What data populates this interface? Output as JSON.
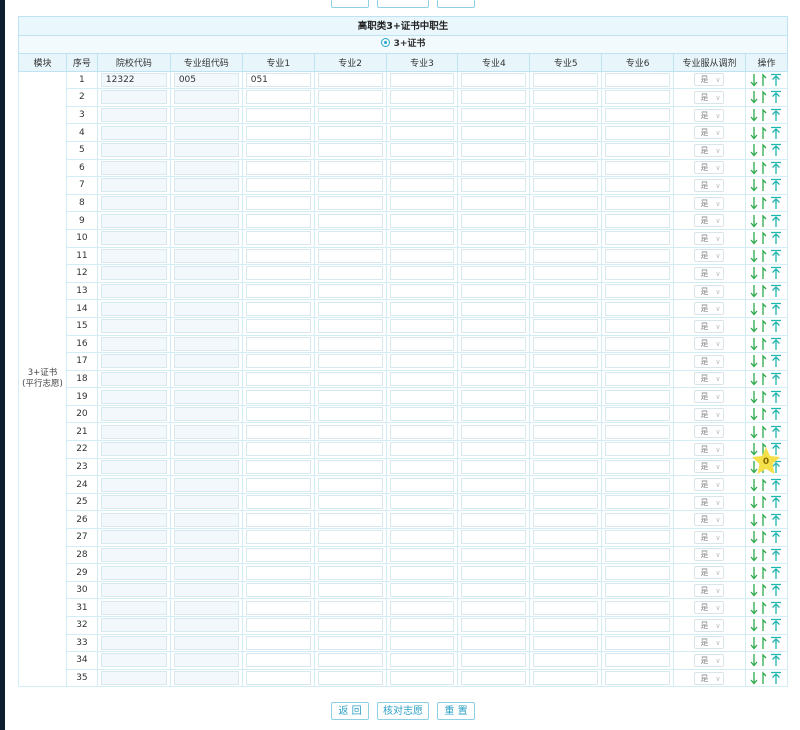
{
  "top_buttons": [
    "",
    "",
    ""
  ],
  "header": {
    "title": "高职类3+证书中职生",
    "radio_label": "3+证书"
  },
  "columns": [
    "模块",
    "序号",
    "院校代码",
    "专业组代码",
    "专业1",
    "专业2",
    "专业3",
    "专业4",
    "专业5",
    "专业6",
    "专业服从调剂",
    "操作"
  ],
  "module": {
    "line1": "3+证书",
    "line2": "(平行志愿)"
  },
  "rows": [
    {
      "seq": "1",
      "school": "12322",
      "group": "005",
      "m1": "051",
      "adjust": "是"
    },
    {
      "seq": "2",
      "adjust": "是"
    },
    {
      "seq": "3",
      "adjust": "是"
    },
    {
      "seq": "4",
      "adjust": "是"
    },
    {
      "seq": "5",
      "adjust": "是"
    },
    {
      "seq": "6",
      "adjust": "是"
    },
    {
      "seq": "7",
      "adjust": "是"
    },
    {
      "seq": "8",
      "adjust": "是"
    },
    {
      "seq": "9",
      "adjust": "是"
    },
    {
      "seq": "10",
      "adjust": "是"
    },
    {
      "seq": "11",
      "adjust": "是"
    },
    {
      "seq": "12",
      "adjust": "是"
    },
    {
      "seq": "13",
      "adjust": "是"
    },
    {
      "seq": "14",
      "adjust": "是"
    },
    {
      "seq": "15",
      "adjust": "是"
    },
    {
      "seq": "16",
      "adjust": "是"
    },
    {
      "seq": "17",
      "adjust": "是"
    },
    {
      "seq": "18",
      "adjust": "是"
    },
    {
      "seq": "19",
      "adjust": "是"
    },
    {
      "seq": "20",
      "adjust": "是"
    },
    {
      "seq": "21",
      "adjust": "是"
    },
    {
      "seq": "22",
      "adjust": "是"
    },
    {
      "seq": "23",
      "adjust": "是"
    },
    {
      "seq": "24",
      "adjust": "是"
    },
    {
      "seq": "25",
      "adjust": "是"
    },
    {
      "seq": "26",
      "adjust": "是"
    },
    {
      "seq": "27",
      "adjust": "是"
    },
    {
      "seq": "28",
      "adjust": "是"
    },
    {
      "seq": "29",
      "adjust": "是"
    },
    {
      "seq": "30",
      "adjust": "是"
    },
    {
      "seq": "31",
      "adjust": "是"
    },
    {
      "seq": "32",
      "adjust": "是"
    },
    {
      "seq": "33",
      "adjust": "是"
    },
    {
      "seq": "34",
      "adjust": "是"
    },
    {
      "seq": "35",
      "adjust": "是"
    }
  ],
  "ops_icons": [
    "move-down-icon",
    "move-up-icon",
    "move-top-icon"
  ],
  "colors": {
    "op_green": "#2ba94a",
    "op_teal": "#1fb5b0",
    "accent": "#2a9fc6",
    "badge": "#f5e04a"
  },
  "badge": {
    "value": "0"
  },
  "bottom_buttons": {
    "back": "返 回",
    "verify": "核对志愿",
    "reset": "重 置"
  }
}
